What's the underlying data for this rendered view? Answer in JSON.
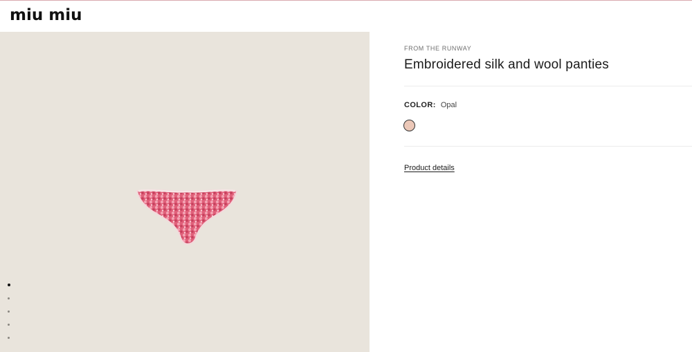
{
  "header": {
    "logo": "miu miu"
  },
  "gallery": {
    "image_name": "embroidered-panties-image",
    "slide_count": 5,
    "active_slide": 1
  },
  "product": {
    "eyebrow": "FROM THE RUNWAY",
    "title": "Embroidered silk and wool panties",
    "color_label": "COLOR:",
    "color_value": "Opal",
    "swatch_color": "#ecc8b8",
    "details_link": "Product details"
  },
  "colors": {
    "accent_line": "#d9a9ae",
    "gallery_bg": "#e9e4dc"
  }
}
